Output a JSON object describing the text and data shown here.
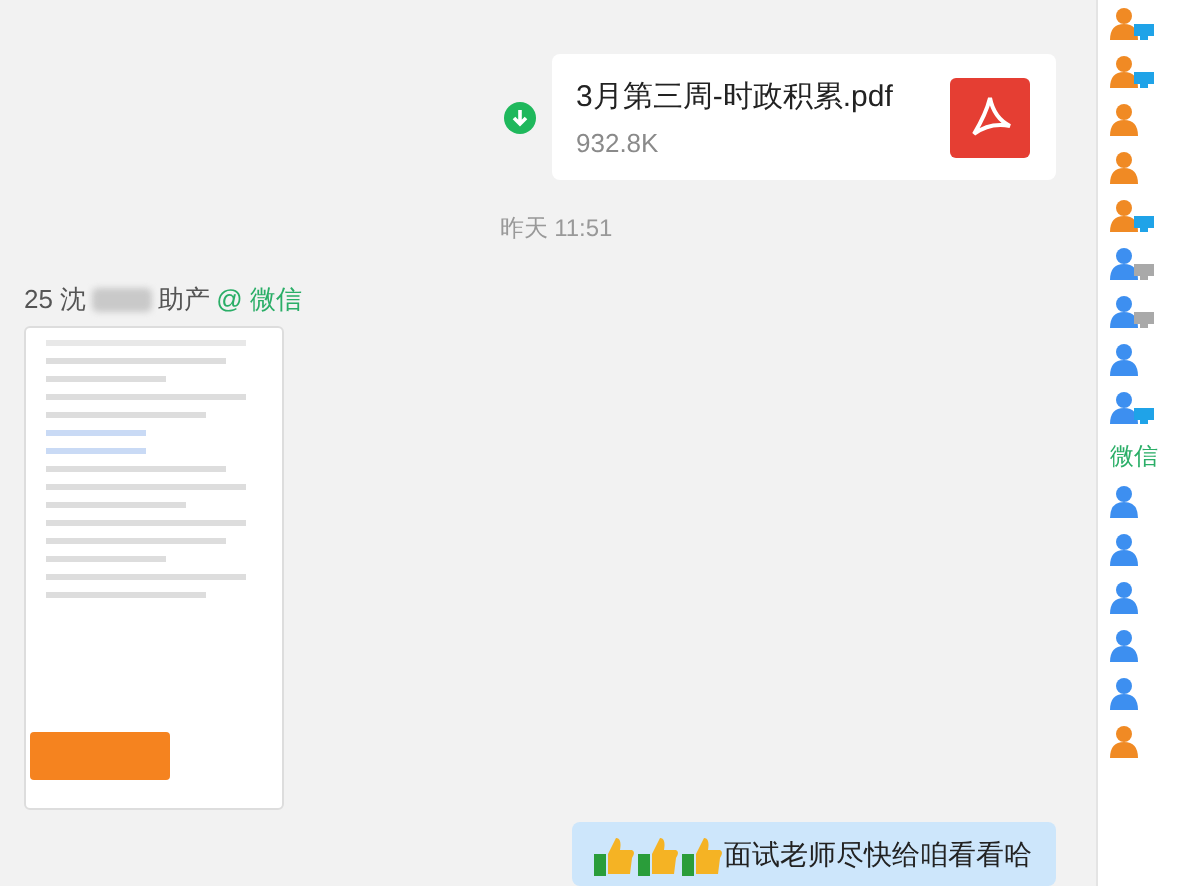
{
  "file_message": {
    "name": "3月第三周-时政积累.pdf",
    "size": "932.8K"
  },
  "timestamp": "昨天 11:51",
  "sender": {
    "prefix": "25 沈",
    "suffix": "助产",
    "source": "@ 微信"
  },
  "reply_message": {
    "parts": [
      {
        "kind": "thumbs-up"
      },
      {
        "kind": "thumbs-up"
      },
      {
        "kind": "thumbs-up"
      },
      {
        "kind": "text",
        "text": "面试老师尽快给咱看看哈"
      }
    ]
  },
  "members": [
    {
      "color": "#f08a24",
      "kind": "pc"
    },
    {
      "color": "#f08a24",
      "kind": "pc"
    },
    {
      "color": "#f08a24",
      "kind": "plain"
    },
    {
      "color": "#f08a24",
      "kind": "plain"
    },
    {
      "color": "#f08a24",
      "kind": "pc"
    },
    {
      "color": "#3d8ff0",
      "kind": "pc-offline"
    },
    {
      "color": "#3d8ff0",
      "kind": "pc-offline"
    },
    {
      "color": "#3d8ff0",
      "kind": "plain"
    },
    {
      "color": "#3d8ff0",
      "kind": "pc"
    }
  ],
  "wechat_group": {
    "title": "微信",
    "members": [
      {
        "color": "#3d8ff0"
      },
      {
        "color": "#3d8ff0"
      },
      {
        "color": "#3d8ff0"
      },
      {
        "color": "#3d8ff0"
      },
      {
        "color": "#3d8ff0"
      },
      {
        "color": "#f08a24"
      }
    ]
  }
}
